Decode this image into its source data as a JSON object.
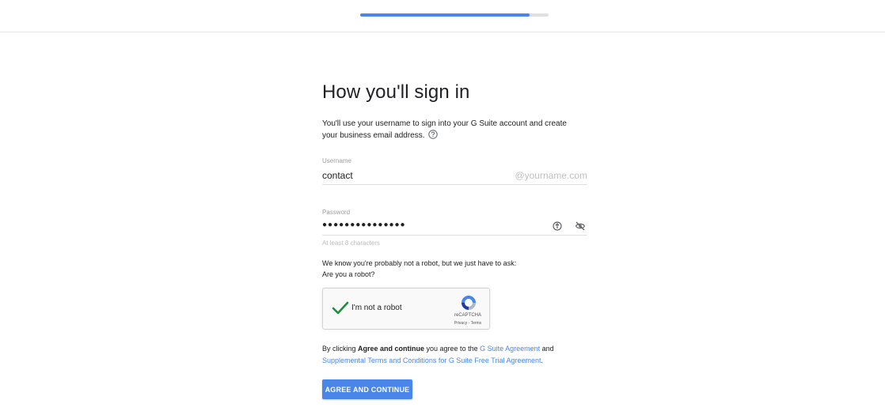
{
  "progress": {
    "fraction": 0.9
  },
  "colors": {
    "accent": "#4a86e8",
    "check": "#1e8e3e",
    "track": "#e0e0e0"
  },
  "title": "How you'll sign in",
  "intro": "You'll use your username to sign into your G Suite account and create your business email address.",
  "username": {
    "label": "Username",
    "value": "contact",
    "suffix": "@yourname.com"
  },
  "password": {
    "label": "Password",
    "dots": "●●●●●●●●●●●●●●●",
    "hint": "At least 8 characters",
    "icons": [
      "password-generator-icon",
      "visibility-off-icon"
    ]
  },
  "robot": {
    "line1": "We know you're probably not a robot, but we just have to ask:",
    "line2": "Are you a robot?"
  },
  "captcha": {
    "label": "I'm not a robot",
    "brand": "reCAPTCHA",
    "privacy": "Privacy",
    "separator": " - ",
    "terms": "Terms"
  },
  "terms": {
    "prefix": "By clicking ",
    "bold": "Agree and continue",
    "middle": " you agree to the ",
    "link1": "G Suite Agreement",
    "and": " and",
    "link2": "Supplemental Terms and Conditions for G Suite Free Trial Agreement",
    "suffix": "."
  },
  "button": {
    "label": "AGREE AND CONTINUE"
  }
}
